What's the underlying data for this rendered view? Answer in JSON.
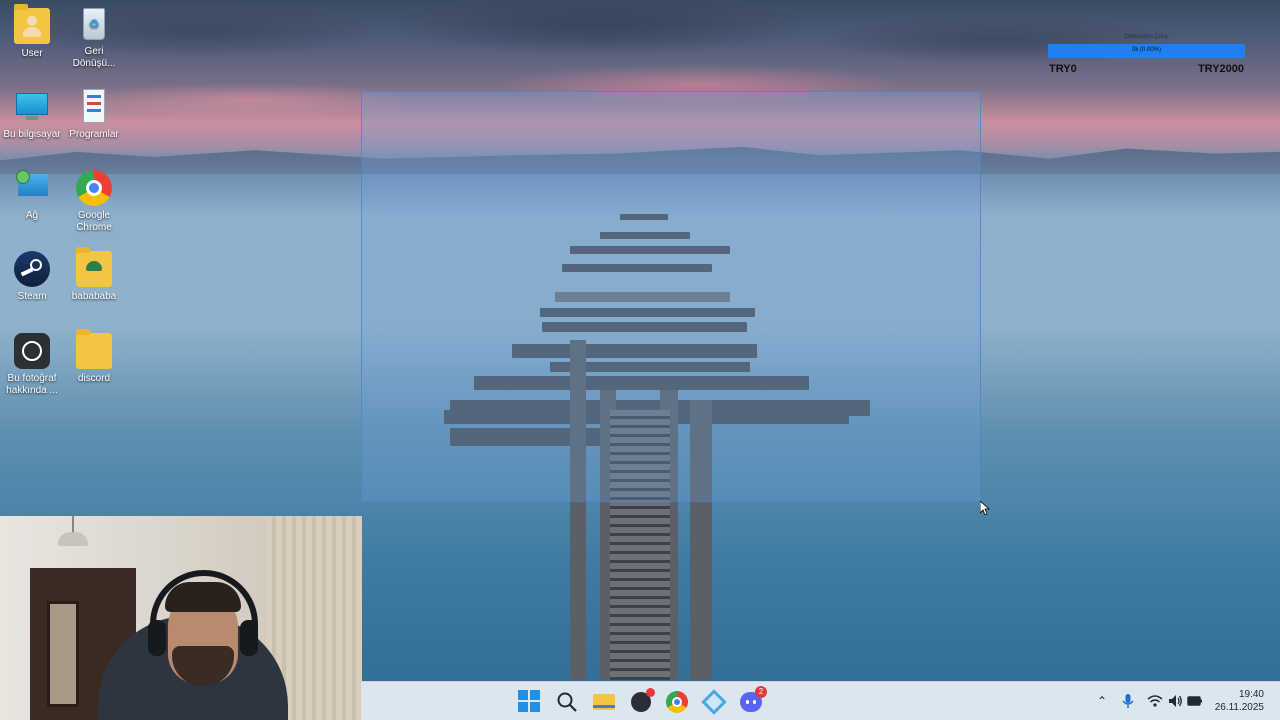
{
  "desktop": {
    "icons": [
      {
        "label": "User",
        "icon": "user-folder-icon"
      },
      {
        "label": "Geri Dönüşü...",
        "icon": "recycle-bin-icon"
      },
      {
        "label": "Bu bilgisayar",
        "icon": "computer-icon"
      },
      {
        "label": "Programlar",
        "icon": "programs-icon"
      },
      {
        "label": "Ağ",
        "icon": "network-icon"
      },
      {
        "label": "Google Chrome",
        "icon": "chrome-icon"
      },
      {
        "label": "Steam",
        "icon": "steam-icon"
      },
      {
        "label": "babababa",
        "icon": "folder-icon"
      },
      {
        "label": "Bu fotoğraf hakkında ...",
        "icon": "photo-info-icon"
      },
      {
        "label": "discord",
        "icon": "folder-icon"
      }
    ]
  },
  "widget": {
    "title": "Dilenciden Çıkış",
    "progress_text": "0k (0.00%)",
    "progress_fraction": 0.0,
    "min_label": "TRY0",
    "max_label": "TRY2000"
  },
  "taskbar": {
    "apps": [
      {
        "name": "start",
        "icon": "windows-start-icon"
      },
      {
        "name": "search",
        "icon": "search-icon"
      },
      {
        "name": "file-explorer",
        "icon": "file-explorer-icon"
      },
      {
        "name": "app",
        "icon": "app-icon",
        "badge": ""
      },
      {
        "name": "chrome",
        "icon": "chrome-icon"
      },
      {
        "name": "app2",
        "icon": "app2-icon"
      },
      {
        "name": "discord",
        "icon": "discord-icon",
        "badge": "2"
      }
    ],
    "time": "19:40",
    "date": "26.11.2025"
  },
  "colors": {
    "selection": "#6ea0dc",
    "progress_bar": "#1f7ff5",
    "taskbar": "#dbe6ef",
    "badge": "#e53939"
  }
}
